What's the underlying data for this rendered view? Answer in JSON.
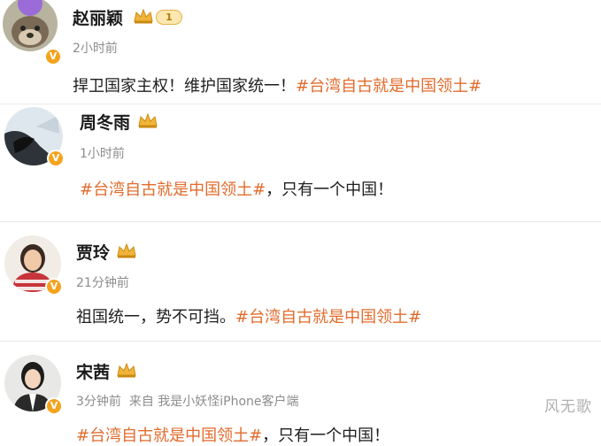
{
  "posts": [
    {
      "username": "赵丽颖",
      "vip_level": "1",
      "time": "2小时前",
      "source": "",
      "text_before": "捍卫国家主权！维护国家统一！",
      "hashtag": "#台湾自古就是中国领土#",
      "text_after": ""
    },
    {
      "username": "周冬雨",
      "vip_level": "",
      "time": "1小时前",
      "source": "",
      "text_before": "",
      "hashtag": "#台湾自古就是中国领土#",
      "text_after": "，只有一个中国！"
    },
    {
      "username": "贾玲",
      "vip_level": "",
      "time": "21分钟前",
      "source": "",
      "text_before": "祖国统一，势不可挡。",
      "hashtag": "#台湾自古就是中国领土#",
      "text_after": ""
    },
    {
      "username": "宋茜",
      "vip_level": "",
      "time": "3分钟前",
      "source": "来自 我是小妖怪iPhone客户端",
      "text_before": "",
      "hashtag": "#台湾自古就是中国领土#",
      "text_after": "，只有一个中国！"
    }
  ],
  "verified_badge": "V",
  "watermark": "风无歌",
  "colors": {
    "hashtag": "#e16b2c",
    "verified": "#f4a31e",
    "meta": "#8c8c8c"
  },
  "icons": [
    "verified-badge-icon",
    "vip-crown-icon"
  ]
}
